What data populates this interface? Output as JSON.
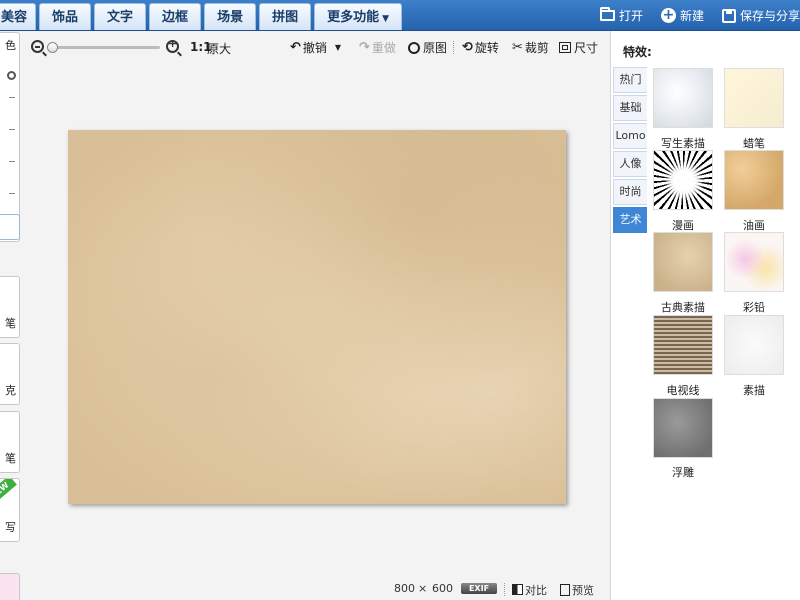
{
  "tabs": [
    {
      "label": "美容"
    },
    {
      "label": "饰品"
    },
    {
      "label": "文字"
    },
    {
      "label": "边框"
    },
    {
      "label": "场景"
    },
    {
      "label": "拼图"
    },
    {
      "label": "更多功能"
    }
  ],
  "top_actions": {
    "open": "打开",
    "new": "新建",
    "save": "保存与分享"
  },
  "left_strip": {
    "labels": [
      "色",
      "笔",
      "克",
      "笔",
      "写"
    ]
  },
  "toolbar": {
    "zoom_fraction": 0.0,
    "ratio": "1:1",
    "original_size": "原大",
    "undo": "撤销",
    "redo": "重做",
    "original": "原图",
    "rotate": "旋转",
    "crop": "裁剪",
    "size": "尺寸"
  },
  "status": {
    "width": "800",
    "times": "×",
    "height": "600",
    "exif": "EXIF",
    "compare": "对比",
    "preview": "预览"
  },
  "effects_panel": {
    "title": "特效:",
    "categories": [
      {
        "label": "热门",
        "active": false
      },
      {
        "label": "基础",
        "active": false
      },
      {
        "label": "Lomo",
        "active": false
      },
      {
        "label": "人像",
        "active": false
      },
      {
        "label": "时尚",
        "active": false
      },
      {
        "label": "艺术",
        "active": true
      }
    ],
    "effects": [
      {
        "label": "写生素描"
      },
      {
        "label": "蜡笔"
      },
      {
        "label": "漫画"
      },
      {
        "label": "油画"
      },
      {
        "label": "古典素描"
      },
      {
        "label": "彩铅"
      },
      {
        "label": "电视线"
      },
      {
        "label": "素描"
      },
      {
        "label": "浮雕"
      }
    ]
  },
  "colors": {
    "topbar": "#2d6bb8",
    "active_category": "#3f86d6",
    "new_badge": "#3fae3f"
  }
}
